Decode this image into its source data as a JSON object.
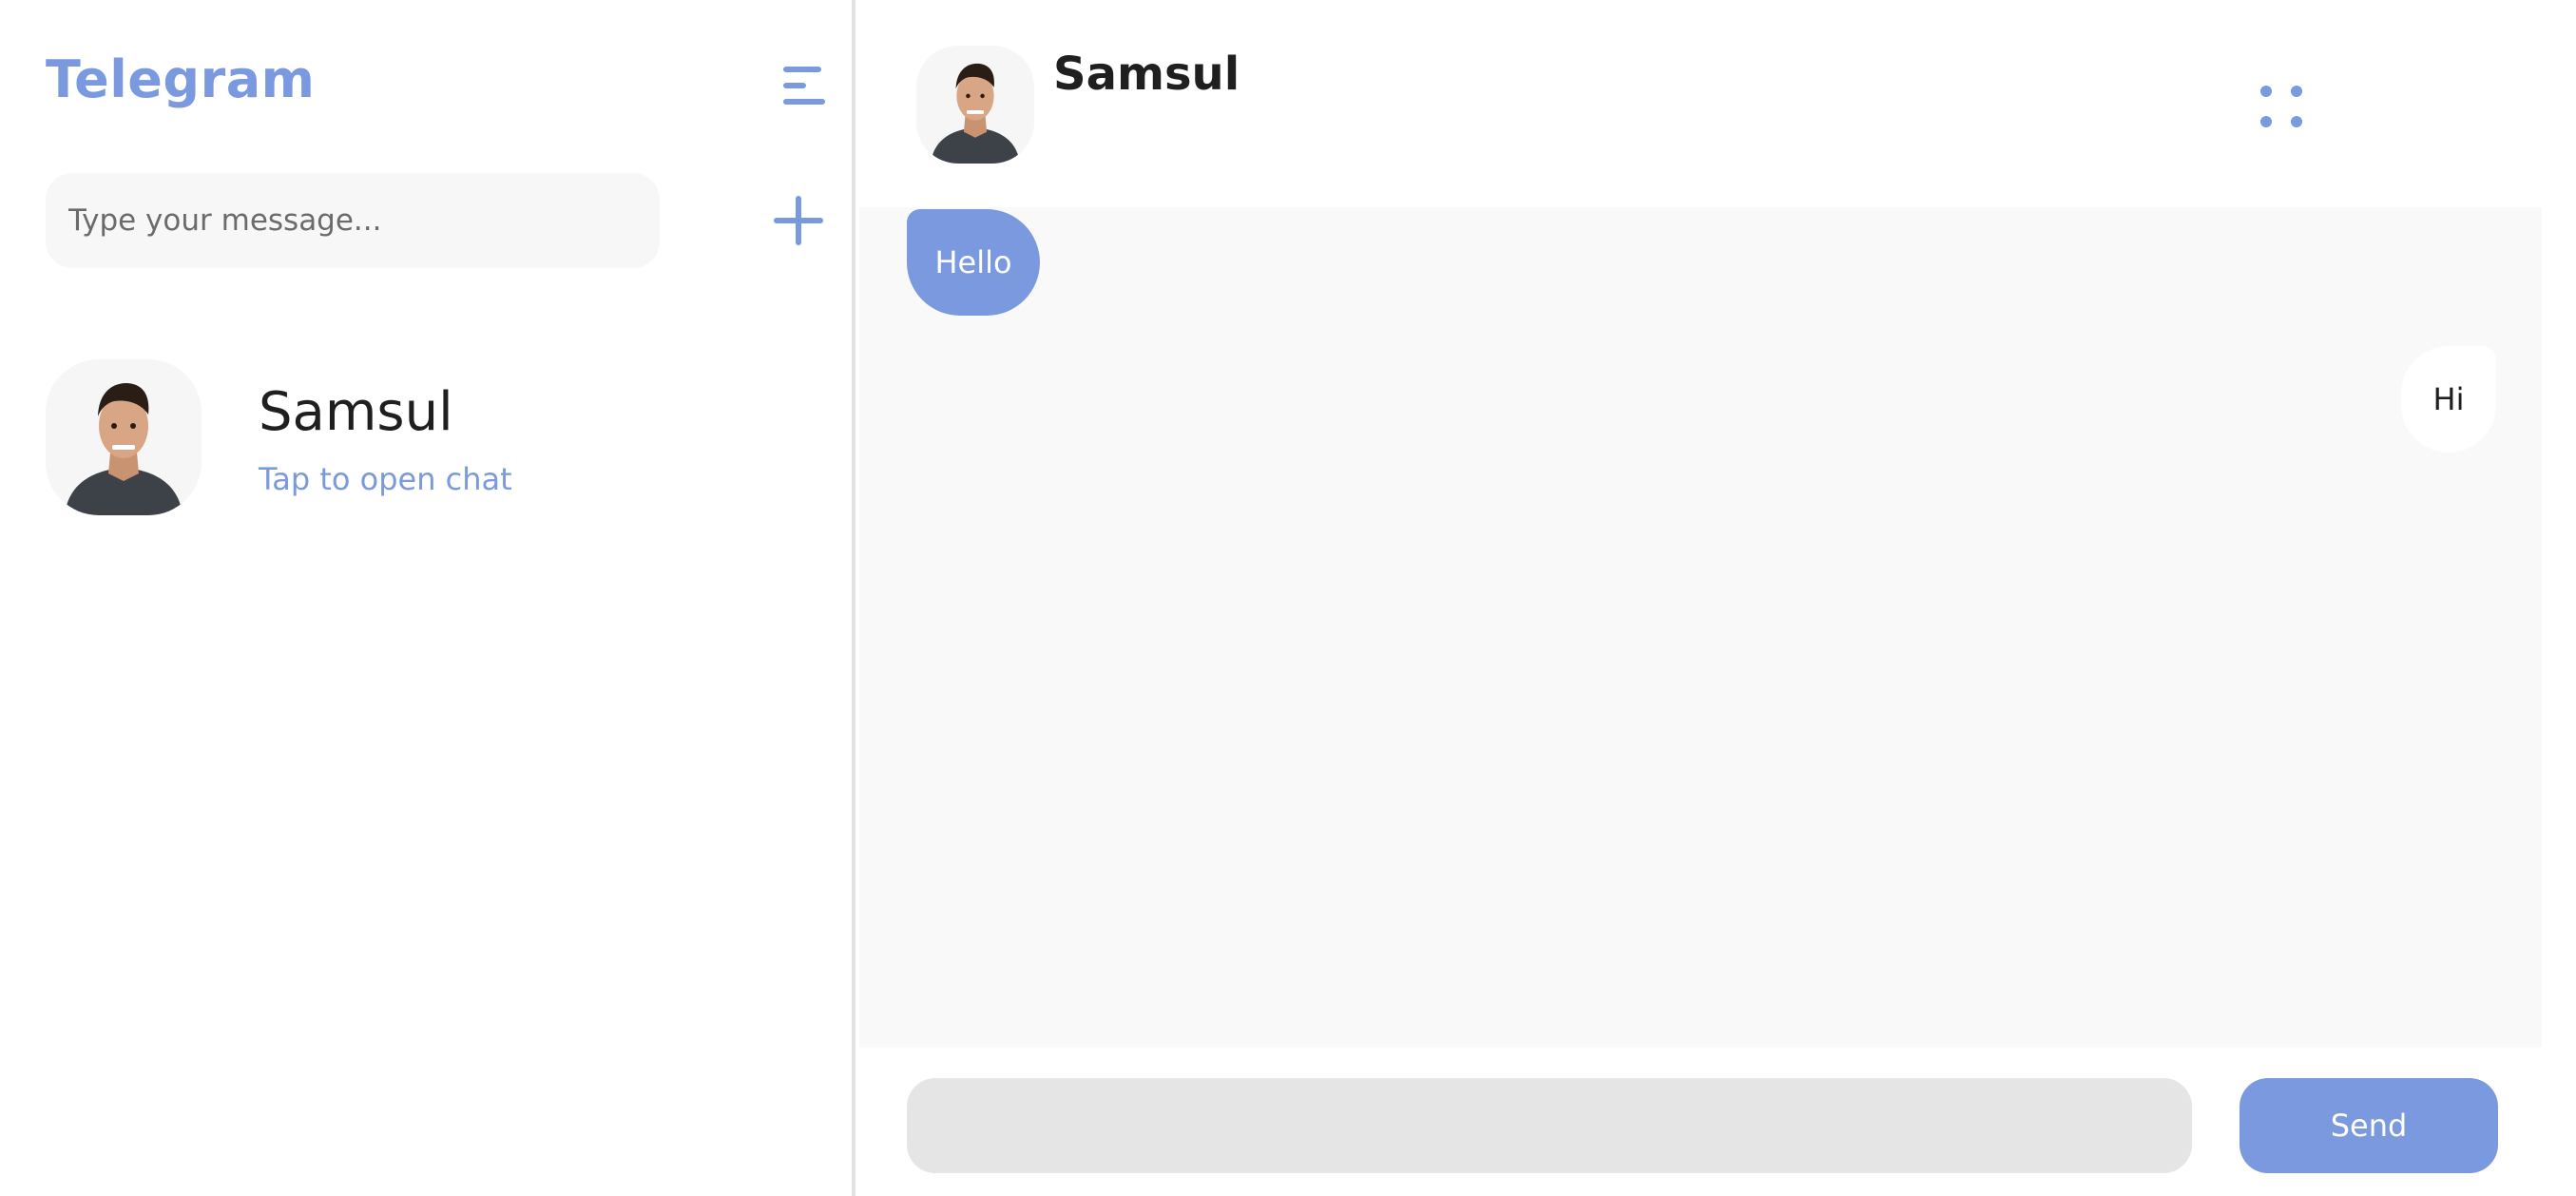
{
  "sidebar": {
    "title": "Telegram",
    "menu_icon": "hamburger-menu-icon",
    "search": {
      "placeholder": "Type your message...",
      "value": ""
    },
    "add_icon": "plus-icon",
    "chats": [
      {
        "name": "Samsul",
        "subtitle": "Tap to open chat",
        "avatar": "person-avatar"
      }
    ]
  },
  "chat": {
    "header": {
      "name": "Samsul",
      "avatar": "person-avatar",
      "more_icon": "dots-grid-icon"
    },
    "messages": [
      {
        "text": "Hello",
        "direction": "incoming"
      },
      {
        "text": "Hi",
        "direction": "outgoing"
      }
    ],
    "composer": {
      "value": "",
      "placeholder": "",
      "send_label": "Send"
    }
  },
  "colors": {
    "accent": "#7b99de",
    "text": "#1f1f1f",
    "messages_bg": "#f9f9f9",
    "composer_bg": "#e5e5e5",
    "search_bg": "#f7f7f7",
    "divider": "#e2e2e2"
  }
}
